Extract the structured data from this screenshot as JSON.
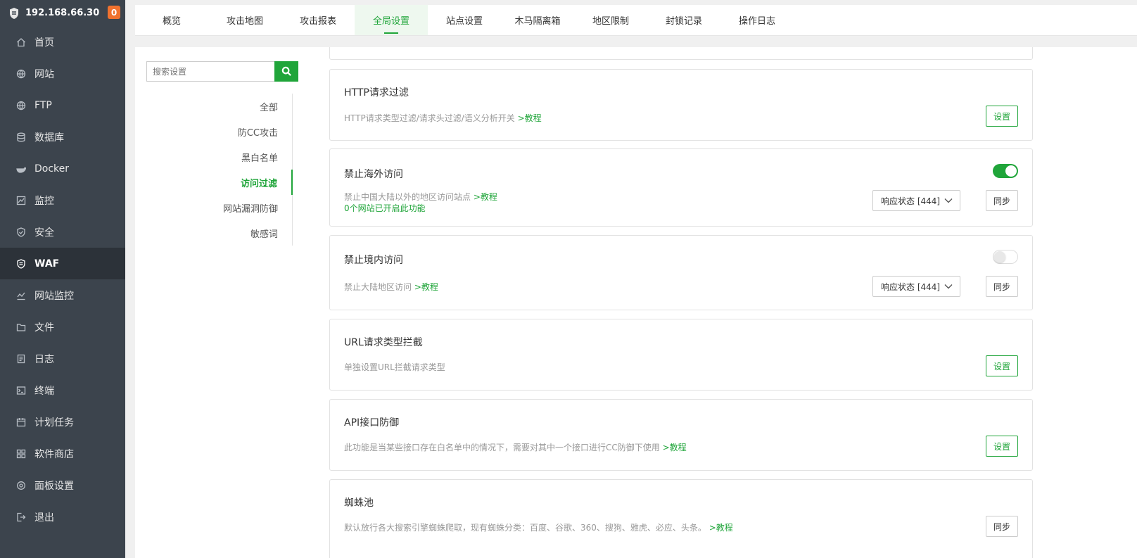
{
  "sidebar": {
    "host": "192.168.66.30",
    "badge": "0",
    "items": [
      {
        "label": "首页",
        "icon": "home-icon"
      },
      {
        "label": "网站",
        "icon": "globe-icon"
      },
      {
        "label": "FTP",
        "icon": "globe-icon"
      },
      {
        "label": "数据库",
        "icon": "database-icon"
      },
      {
        "label": "Docker",
        "icon": "docker-icon"
      },
      {
        "label": "监控",
        "icon": "monitor-icon"
      },
      {
        "label": "安全",
        "icon": "shield-icon"
      },
      {
        "label": "WAF",
        "icon": "waf-shield-icon"
      },
      {
        "label": "网站监控",
        "icon": "chart-icon"
      },
      {
        "label": "文件",
        "icon": "folder-icon"
      },
      {
        "label": "日志",
        "icon": "log-icon"
      },
      {
        "label": "终端",
        "icon": "terminal-icon"
      },
      {
        "label": "计划任务",
        "icon": "calendar-icon"
      },
      {
        "label": "软件商店",
        "icon": "apps-icon"
      },
      {
        "label": "面板设置",
        "icon": "gear-icon"
      },
      {
        "label": "退出",
        "icon": "logout-icon"
      }
    ]
  },
  "tabs": [
    {
      "label": "概览"
    },
    {
      "label": "攻击地图"
    },
    {
      "label": "攻击报表"
    },
    {
      "label": "全局设置"
    },
    {
      "label": "站点设置"
    },
    {
      "label": "木马隔离箱"
    },
    {
      "label": "地区限制"
    },
    {
      "label": "封锁记录"
    },
    {
      "label": "操作日志"
    }
  ],
  "search": {
    "placeholder": "搜索设置"
  },
  "subnav": [
    {
      "label": "全部"
    },
    {
      "label": "防CC攻击"
    },
    {
      "label": "黑白名单"
    },
    {
      "label": "访问过滤"
    },
    {
      "label": "网站漏洞防御"
    },
    {
      "label": "敏感词"
    }
  ],
  "cards": {
    "http_filter": {
      "title": "HTTP请求过滤",
      "desc": "HTTP请求类型过滤/请求头过滤/语义分析开关",
      "link": ">教程",
      "button": "设置"
    },
    "block_overseas": {
      "title": "禁止海外访问",
      "desc": "禁止中国大陆以外的地区访问站点",
      "link": ">教程",
      "sub": "0个网站已开启此功能",
      "select": "响应状态 [444]",
      "button": "同步",
      "enabled": true
    },
    "block_domestic": {
      "title": "禁止境内访问",
      "desc": "禁止大陆地区访问",
      "link": ">教程",
      "select": "响应状态 [444]",
      "button": "同步",
      "enabled": false
    },
    "url_type": {
      "title": "URL请求类型拦截",
      "desc": "单独设置URL拦截请求类型",
      "button": "设置"
    },
    "api_defense": {
      "title": "API接口防御",
      "desc": "此功能是当某些接口存在白名单中的情况下，需要对其中一个接口进行CC防御下使用",
      "link": ">教程",
      "button": "设置"
    },
    "spider_pool": {
      "title": "蜘蛛池",
      "desc": "默认放行各大搜索引擎蜘蛛爬取，现有蜘蛛分类：百度、谷歌、360、搜狗、雅虎、必应、头条。",
      "link": ">教程",
      "button": "同步"
    }
  },
  "colors": {
    "accent": "#20a53a",
    "sidebar": "#3c444d",
    "badge": "#f0722f"
  }
}
